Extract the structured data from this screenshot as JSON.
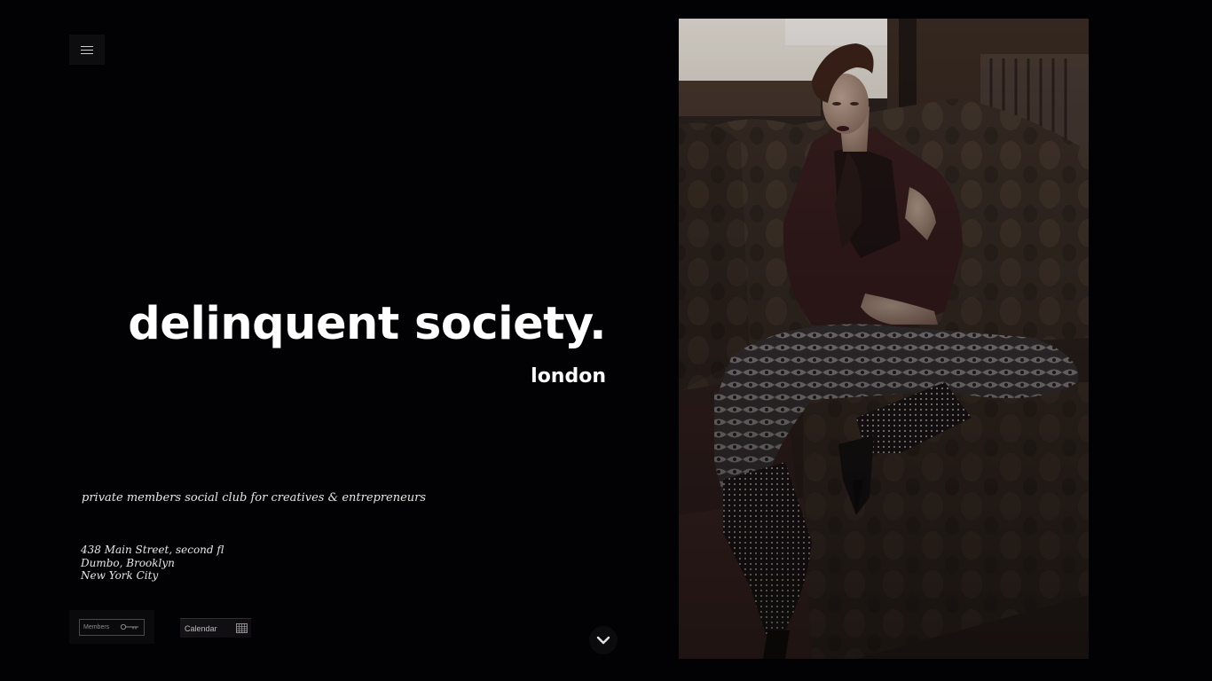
{
  "header": {
    "menu_icon": "hamburger-menu-icon"
  },
  "hero": {
    "title": "delinquent society.",
    "city": "london",
    "tagline": "private members social club for creatives & entrepreneurs",
    "address": [
      "438 Main Street, second fl",
      "Dumbo, Brooklyn",
      "New York City"
    ]
  },
  "actions": {
    "members_label": "Members",
    "members_icon": "key-icon",
    "calendar_label": "Calendar",
    "calendar_icon": "calendar-grid-icon",
    "scroll_icon": "chevron-down-icon"
  },
  "photo": {
    "subject": "model-on-sofa-photo"
  },
  "colors": {
    "background": "#020103",
    "text": "#ffffff"
  }
}
